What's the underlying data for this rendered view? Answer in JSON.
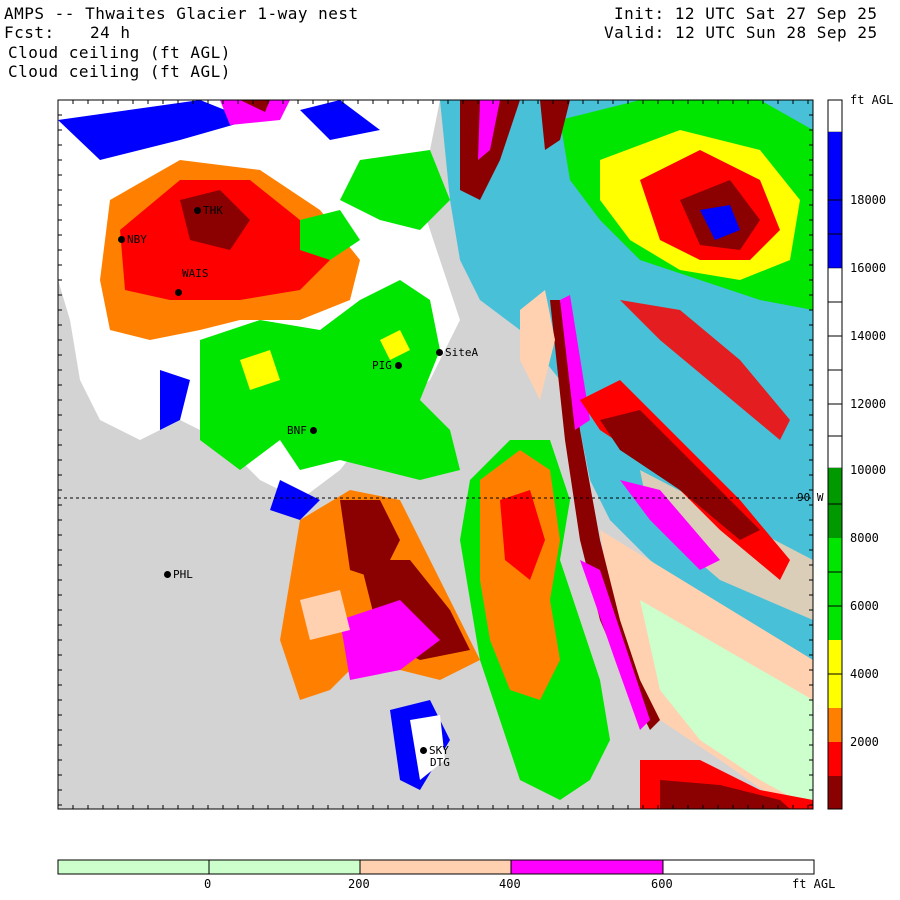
{
  "header": {
    "title": "AMPS -- Thwaites Glacier 1-way nest",
    "forecast_label": "Fcst:",
    "forecast_hours": "24 h",
    "field_line_1": "Cloud ceiling (ft AGL)",
    "field_line_2": "Cloud ceiling (ft AGL)",
    "init_time": "Init: 12 UTC Sat 27 Sep 25",
    "valid_time": "Valid: 12 UTC Sun 28 Sep 25"
  },
  "map": {
    "latitude_line_label": "90 W",
    "stations": [
      {
        "name": "THK"
      },
      {
        "name": "NBY"
      },
      {
        "name": "WAIS"
      },
      {
        "name": "SiteA"
      },
      {
        "name": "PIG"
      },
      {
        "name": "BNF"
      },
      {
        "name": "PHL"
      },
      {
        "name": "SKY"
      },
      {
        "name": "DTG"
      }
    ]
  },
  "colorbar_vertical": {
    "unit": "ft AGL",
    "ticks": [
      "18000",
      "16000",
      "14000",
      "12000",
      "10000",
      "8000",
      "6000",
      "4000",
      "2000"
    ],
    "colors": {
      "white_top": "#ffffff",
      "blue": "#0000ff",
      "dark_green": "#009900",
      "green": "#00e600",
      "yellow": "#ffff00",
      "orange": "#ff8000",
      "red": "#ff0000",
      "dark_red": "#8b0000"
    }
  },
  "colorbar_horizontal": {
    "unit": "ft AGL",
    "ticks": [
      "0",
      "200",
      "400",
      "600"
    ],
    "colors": {
      "light_green": "#ccffcc",
      "peach": "#ffd1b0",
      "magenta": "#ff00ff",
      "white": "#ffffff"
    }
  },
  "colors": {
    "land": "#d3d3d3",
    "ocean": "#48c0d8"
  }
}
